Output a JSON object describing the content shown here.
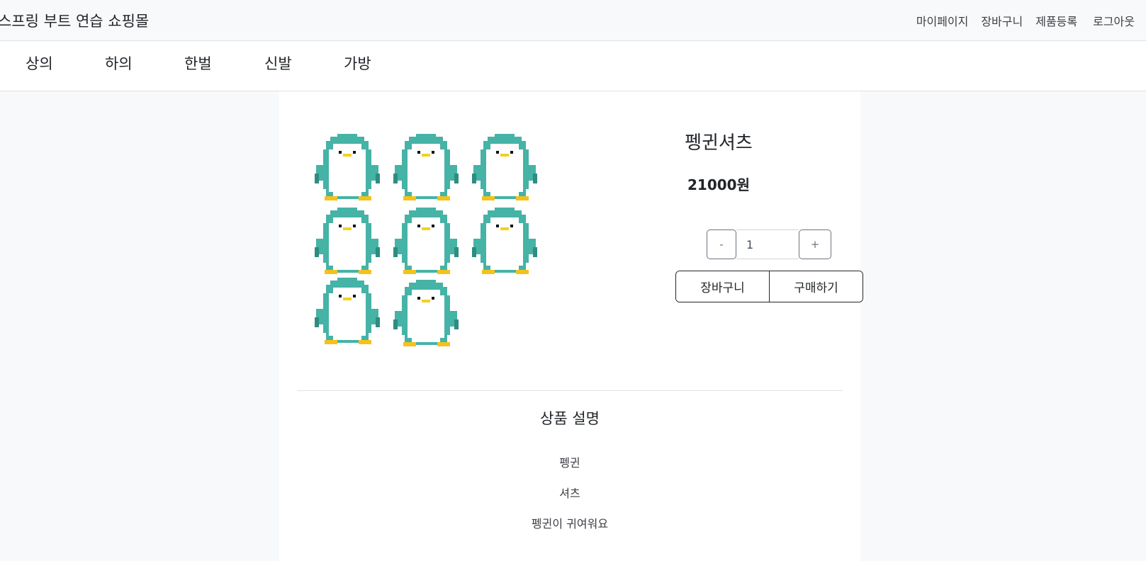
{
  "header": {
    "brand": "스프링 부트 연습 쇼핑몰",
    "links": [
      "마이페이지",
      "장바구니",
      "제품등록",
      "로그아웃"
    ]
  },
  "categories": [
    "상의",
    "하의",
    "한벌",
    "신발",
    "가방"
  ],
  "product": {
    "name": "펭귄셔츠",
    "price": "21000원",
    "quantity": "1",
    "minus_label": "-",
    "plus_label": "+",
    "cart_label": "장바구니",
    "buy_label": "구매하기",
    "image_icon": "penguin-icon",
    "colors": {
      "body": "#45b3a6",
      "dark": "#2f8c80",
      "belly": "#ffffff",
      "feet": "#f5c11b",
      "beak": "#f3d21b"
    }
  },
  "description": {
    "title": "상품 설명",
    "lines": [
      "펭귄",
      "셔츠",
      "펭귄이 귀여워요"
    ]
  }
}
